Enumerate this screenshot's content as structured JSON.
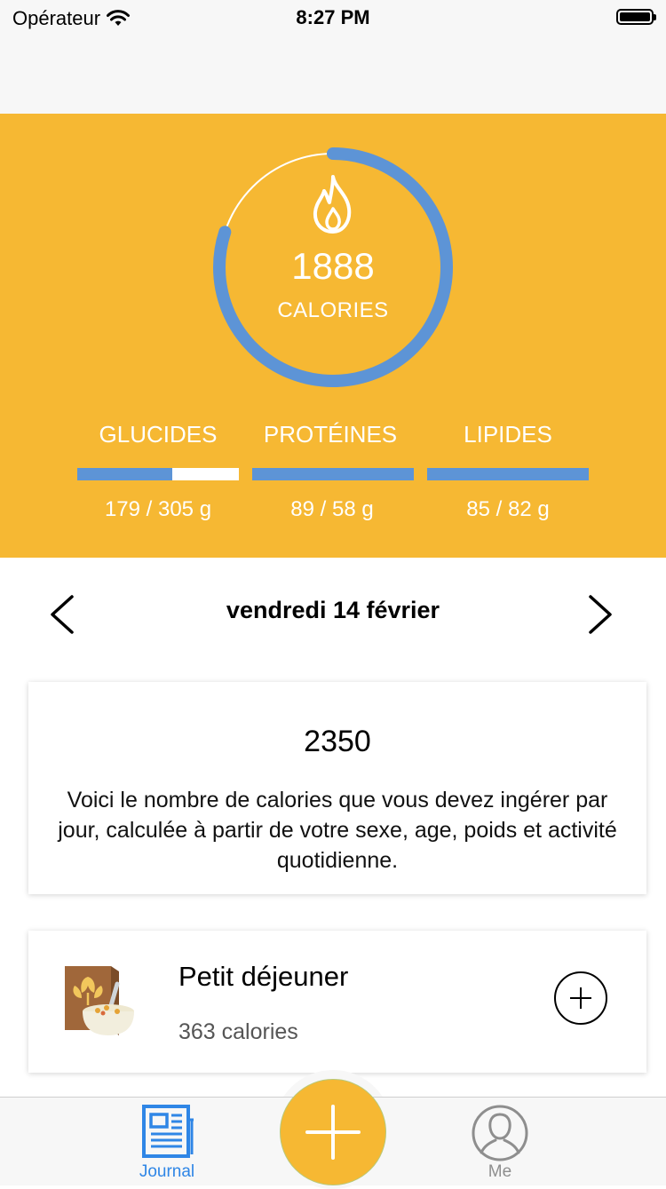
{
  "status_bar": {
    "carrier": "Opérateur",
    "time": "8:27 PM"
  },
  "summary": {
    "calories_value": "1888",
    "calories_label": "CALORIES",
    "calories_ring_progress": 0.8,
    "ring_color": "#5d94d6",
    "background_color": "#f6b833",
    "macros": [
      {
        "label": "GLUCIDES",
        "value": "179 / 305 g",
        "progress": 0.59
      },
      {
        "label": "PROTÉINES",
        "value": "89 / 58 g",
        "progress": 1.0
      },
      {
        "label": "LIPIDES",
        "value": "85 / 82 g",
        "progress": 1.0
      }
    ]
  },
  "date_nav": {
    "date_label": "vendredi 14 février",
    "prev_icon": "chevron-left-icon",
    "next_icon": "chevron-right-icon"
  },
  "goal_card": {
    "value": "2350",
    "description": "Voici le nombre de calories que vous devez ingérer par jour, calculée à partir de votre sexe, age, poids et activité quotidienne."
  },
  "meals": [
    {
      "title": "Petit déjeuner",
      "calories": "363 calories",
      "icon": "cereal-bowl-icon"
    }
  ],
  "tab_bar": {
    "tabs": [
      {
        "label": "Journal",
        "icon": "journal-icon",
        "active": true,
        "color": "#2f86e6"
      },
      {
        "label": "Me",
        "icon": "user-icon",
        "active": false,
        "color": "#8e8e8e"
      }
    ],
    "center_button_icon": "plus-icon"
  }
}
